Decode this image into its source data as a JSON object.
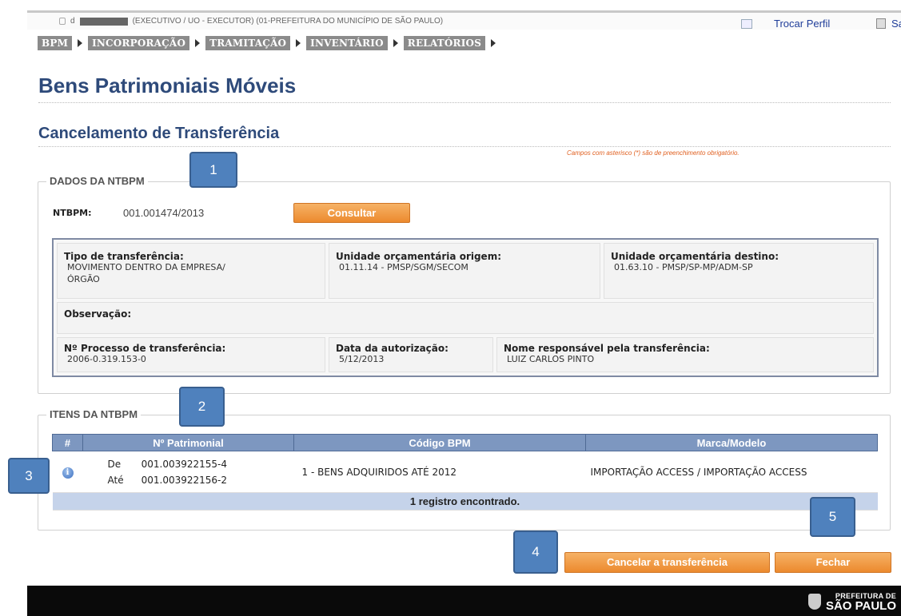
{
  "header": {
    "user_prefix": "d",
    "user_info": "(EXECUTIVO / UO - EXECUTOR) (01-PREFEITURA DO MUNICÍPIO DE SÃO PAULO)",
    "trocar_perfil": "Trocar Perfil",
    "sair": "Sair"
  },
  "nav": {
    "items": [
      {
        "label": "BPM"
      },
      {
        "label": "INCORPORAÇÃO"
      },
      {
        "label": "TRAMITAÇÃO"
      },
      {
        "label": "INVENTÁRIO"
      },
      {
        "label": "RELATÓRIOS"
      }
    ]
  },
  "page": {
    "title": "Bens Patrimoniais Móveis",
    "subtitle": "Cancelamento de Transferência",
    "mandatory_note": "Campos com asterisco (*) são de preenchimento obrigatório."
  },
  "dados": {
    "legend": "DADOS DA NTBPM",
    "ntbpm_label": "NTBPM:",
    "ntbpm_value": "001.001474/2013",
    "consultar_label": "Consultar",
    "tipo_label": "Tipo de transferência:",
    "tipo_value": "MOVIMENTO DENTRO DA EMPRESA/ÓRGÃO",
    "origem_label": "Unidade orçamentária origem:",
    "origem_value": "01.11.14 - PMSP/SGM/SECOM",
    "destino_label": "Unidade orçamentária destino:",
    "destino_value": "01.63.10 - PMSP/SP-MP/ADM-SP",
    "observacao_label": "Observação:",
    "processo_label": "Nº Processo de transferência:",
    "processo_value": "2006-0.319.153-0",
    "data_label": "Data da autorização:",
    "data_value": "5/12/2013",
    "responsavel_label": "Nome responsável pela transferência:",
    "responsavel_value": "LUIZ CARLOS PINTO"
  },
  "itens": {
    "legend": "ITENS DA NTBPM",
    "columns": [
      "#",
      "Nº Patrimonial",
      "Código BPM",
      "Marca/Modelo"
    ],
    "rows": [
      {
        "de_label": "De",
        "de_value": "001.003922155-4",
        "ate_label": "Até",
        "ate_value": "001.003922156-2",
        "codigo": "1 -  BENS ADQUIRIDOS ATÉ 2012",
        "marca": "IMPORTAÇÃO ACCESS  /  IMPORTAÇÃO ACCESS"
      }
    ],
    "footer": "1 registro encontrado."
  },
  "actions": {
    "cancelar_label": "Cancelar a transferência",
    "fechar_label": "Fechar"
  },
  "callouts": [
    "1",
    "2",
    "3",
    "4",
    "5"
  ],
  "footer_logo": {
    "line1": "PREFEITURA DE",
    "line2": "SÃO PAULO"
  },
  "colors": {
    "title": "#2e4a7a",
    "nav_bg": "#8b8b8b",
    "button_orange": "#ec8a2e",
    "table_header": "#7d97c0",
    "callout": "#4f81bd"
  }
}
